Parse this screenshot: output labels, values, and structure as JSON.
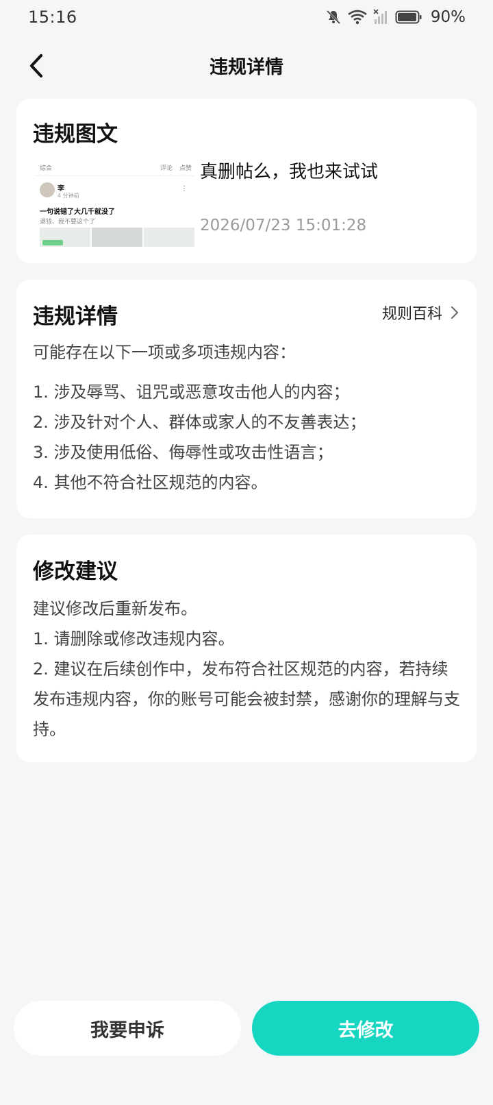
{
  "status_bar": {
    "time": "15:16",
    "battery_text": "90%",
    "icons": [
      "bell-muted-icon",
      "wifi-icon",
      "signal-icon",
      "battery-icon"
    ]
  },
  "nav": {
    "title": "违规详情",
    "back_icon": "chevron-left-icon"
  },
  "violation_post": {
    "title": "违规图文",
    "post_text": "真删帖么，我也来试试",
    "timestamp": "2026/07/23 15:01:28",
    "thumbnail": {
      "tab": "综合",
      "comment": "评论",
      "like": "点赞",
      "user_name": "李",
      "user_time": "4 分钟前",
      "headline": "一句说错了大几千就没了",
      "subline": "退钱、我不要这个了"
    }
  },
  "violation_details": {
    "title": "违规详情",
    "rules_link": "规则百科",
    "intro": "可能存在以下一项或多项违规内容：",
    "items": [
      "1. 涉及辱骂、诅咒或恶意攻击他人的内容；",
      "2. 涉及针对个人、群体或家人的不友善表达；",
      "3. 涉及使用低俗、侮辱性或攻击性语言；",
      "4. 其他不符合社区规范的内容。"
    ]
  },
  "suggestions": {
    "title": "修改建议",
    "lines": [
      "建议修改后重新发布。",
      "1. 请删除或修改违规内容。",
      "2. 建议在后续创作中，发布符合社区规范的内容，若持续发布违规内容，你的账号可能会被封禁，感谢你的理解与支持。"
    ]
  },
  "actions": {
    "appeal": "我要申诉",
    "edit": "去修改"
  },
  "colors": {
    "accent": "#17d6c1",
    "background": "#f5f6f8",
    "card": "#ffffff"
  }
}
